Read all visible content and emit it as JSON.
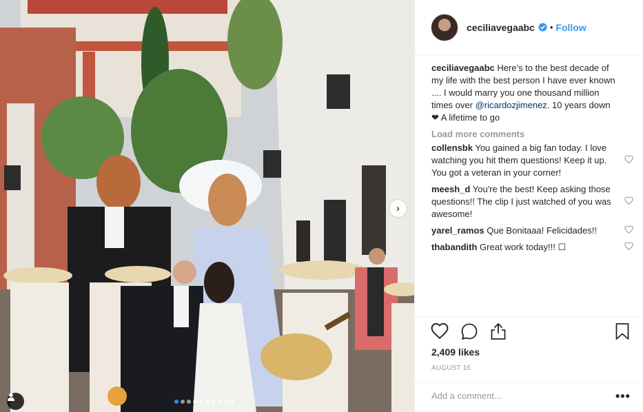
{
  "header": {
    "username": "ceciliavegaabc",
    "verified_icon": "verified-badge-icon",
    "separator": "•",
    "follow_label": "Follow"
  },
  "caption": {
    "author": "ceciliavegaabc",
    "text_before": " Here's to the best decade of my life with the best person I have ever known .... I would marry you one thousand million times over ",
    "mention": "@ricardozjimenez",
    "text_after": ". 10 years down ❤ A lifetime to go"
  },
  "load_more_label": "Load more comments",
  "comments": [
    {
      "author": "collensbk",
      "text": " You gained a big fan today. I love watching you hit them questions! Keep it up. You got a veteran in your corner!"
    },
    {
      "author": "meesh_d",
      "text": " You're the best! Keep asking those questions!! The clip I just watched of you was awesome!"
    },
    {
      "author": "yarel_ramos",
      "text": " Que Bonitaaa! Felicidades!!"
    },
    {
      "author": "thabandith",
      "text": " Great work today!!! ☐"
    }
  ],
  "likes": "2,409 likes",
  "date": "AUGUST 16",
  "add_comment_placeholder": "Add a comment...",
  "more_label": "•••",
  "carousel": {
    "total": 10,
    "active_index": 0
  },
  "next_arrow": "›",
  "colors": {
    "link": "#3897f0",
    "mention": "#003569",
    "muted": "#999999",
    "active_dot": "#1e90ff"
  }
}
